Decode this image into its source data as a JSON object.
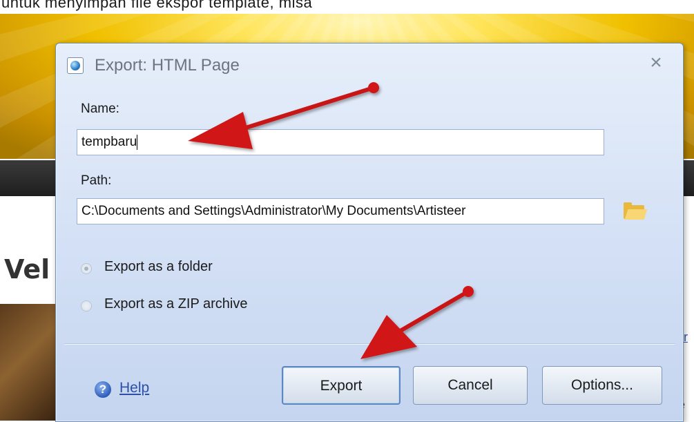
{
  "caption": "untuk menyimpan file ekspor template, misa",
  "background": {
    "heading": "Vel",
    "side_texts": [
      "r",
      "lir",
      "e"
    ]
  },
  "dialog": {
    "title": "Export: HTML Page",
    "close_label": "×",
    "name_label": "Name:",
    "name_value": "tempbaru",
    "path_label": "Path:",
    "path_value": "C:\\Documents and Settings\\Administrator\\My Documents\\Artisteer",
    "options": [
      {
        "label": "Export as a folder",
        "selected": true
      },
      {
        "label": "Export as a ZIP archive",
        "selected": false
      }
    ],
    "help_label": "Help",
    "buttons": {
      "export": "Export",
      "cancel": "Cancel",
      "options": "Options..."
    }
  },
  "colors": {
    "arrow": "#d01616",
    "header_gold": "#f0c000",
    "dialog_bg": "#d3e0f5"
  },
  "icons": [
    "dialog-globe-icon",
    "close-icon",
    "folder-open-icon",
    "help-icon",
    "annotation-arrow-icon"
  ]
}
